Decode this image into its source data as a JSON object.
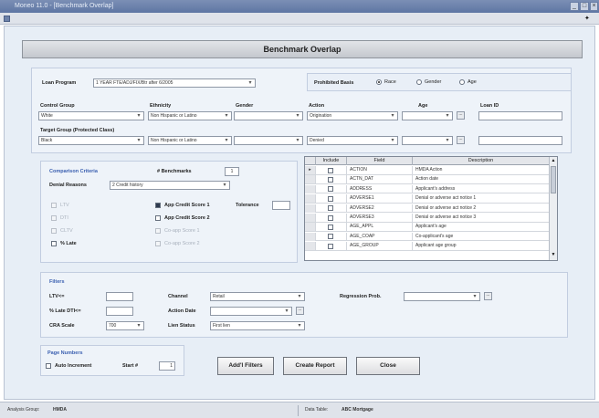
{
  "window": {
    "title": "Moneo 11.0 - [Benchmark Overlap]",
    "controls": [
      "_",
      "□",
      "×"
    ]
  },
  "page_title": "Benchmark Overlap",
  "loan_program": {
    "label": "Loan Program",
    "value": "1 YEAR FTE/ADJ/FIX/Btr  after 6/2005"
  },
  "prohibited_basis": {
    "label": "Prohibited Basis",
    "options": [
      {
        "label": "Race",
        "selected": true
      },
      {
        "label": "Gender",
        "selected": false
      },
      {
        "label": "Age",
        "selected": false
      }
    ]
  },
  "columns": {
    "control_group": "Control Group",
    "ethnicity": "Ethnicity",
    "gender": "Gender",
    "action": "Action",
    "age": "Age",
    "loan_id": "Loan ID"
  },
  "control_row": {
    "group": "White",
    "ethnicity": "Non Hispanic or Latino",
    "gender": "",
    "action": "Origination",
    "age": ""
  },
  "target_group_label": "Target Group (Protected Class)",
  "target_row": {
    "group": "Black",
    "ethnicity": "Non Hispanic or Latino",
    "gender": "",
    "action": "Denied",
    "age": ""
  },
  "comparison": {
    "title": "Comparison Criteria",
    "benchmarks_label": "# Benchmarks",
    "benchmarks_value": "1",
    "denial_reasons_label": "Denial Reasons",
    "denial_reasons_value": "2 Credit history",
    "left_checks": [
      "LTV",
      "DTI",
      "CLTV",
      "% Late"
    ],
    "right_checks": [
      "App Credit Score 1",
      "App Credit Score 2",
      "Co-app Score 1",
      "Co-app Score 2"
    ],
    "tolerance_label": "Tolerance",
    "tolerance_value": ""
  },
  "grid": {
    "headers": [
      "Include",
      "Field",
      "Description"
    ],
    "rows": [
      {
        "field": "ACTION",
        "desc": "HMDA Action"
      },
      {
        "field": "ACTN_DAT",
        "desc": "Action date"
      },
      {
        "field": "ADDRESS",
        "desc": "Applicant's address"
      },
      {
        "field": "ADVERSE1",
        "desc": "Denial or adverse act notice 1"
      },
      {
        "field": "ADVERSE2",
        "desc": "Denial or adverse act notice 2"
      },
      {
        "field": "ADVERSE3",
        "desc": "Denial or adverse act notice 3"
      },
      {
        "field": "AGE_APPL",
        "desc": "Applicant's age"
      },
      {
        "field": "AGE_COAP",
        "desc": "Co-applicant's age"
      },
      {
        "field": "AGE_GROUP",
        "desc": "Applicant age group"
      }
    ]
  },
  "filters": {
    "title": "Filters",
    "ltv_label": "LTV<=",
    "ltv_value": "",
    "late_label": "% Late DTI<=",
    "late_value": "",
    "cra_label": "CRA Scale",
    "cra_value": "700",
    "channel_label": "Channel",
    "channel_value": "Retail",
    "action_date_label": "Action Date",
    "action_date_value": "",
    "lien_status_label": "Lien Status",
    "lien_status_value": "First lien",
    "regression_label": "Regression Prob.",
    "regression_value": ""
  },
  "page_numbers": {
    "title": "Page Numbers",
    "auto_increment_label": "Auto Increment",
    "start_label": "Start #",
    "start_value": "1"
  },
  "buttons": {
    "add_filters": "Add'l Filters",
    "create_report": "Create Report",
    "close": "Close"
  },
  "status": {
    "analysis_group_label": "Analysis Group:",
    "analysis_group_value": "HMDA",
    "data_table_label": "Data Table:",
    "data_table_value": "ABC Mortgage"
  }
}
